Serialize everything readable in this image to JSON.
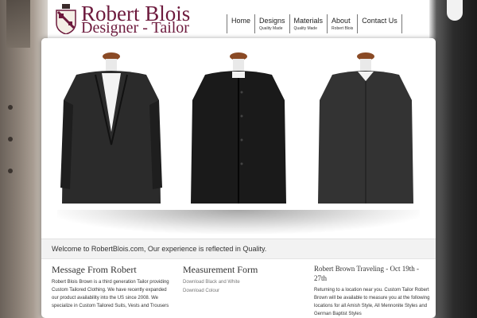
{
  "brand": {
    "name": "Robert Blois",
    "subtitle": "Designer - Tailor"
  },
  "nav": [
    {
      "label": "Home",
      "sub": ""
    },
    {
      "label": "Designs",
      "sub": "Quality Made"
    },
    {
      "label": "Materials",
      "sub": "Quality Made"
    },
    {
      "label": "About",
      "sub": "Robert Blois"
    },
    {
      "label": "Contact Us",
      "sub": ""
    }
  ],
  "welcome": "Welcome to RobertBlois.com, Our experience is reflected in Quality.",
  "message": {
    "title": "Message From Robert",
    "text": "Robert Blois Brown is a third generation Tailor providing Custom Tailored Clothing. We have recently expanded our product availability into the US since 2008. We specialize in Custom Tailored Suits, Vests and Trousers"
  },
  "measurement": {
    "title": "Measurement Form",
    "links": [
      "Download Black and White",
      "Download Colour"
    ]
  },
  "traveling": {
    "title": "Robert Brown Traveling - Oct 19th - 27th",
    "text": "Returning to a location near you.  Custom Tailor Robert Brown will be available to measure you at the following locations for all Amish Style, All Mennonite Styles and German Baptist Styles"
  },
  "colors": {
    "brand": "#6d1a3d",
    "nav_text": "#222222"
  }
}
